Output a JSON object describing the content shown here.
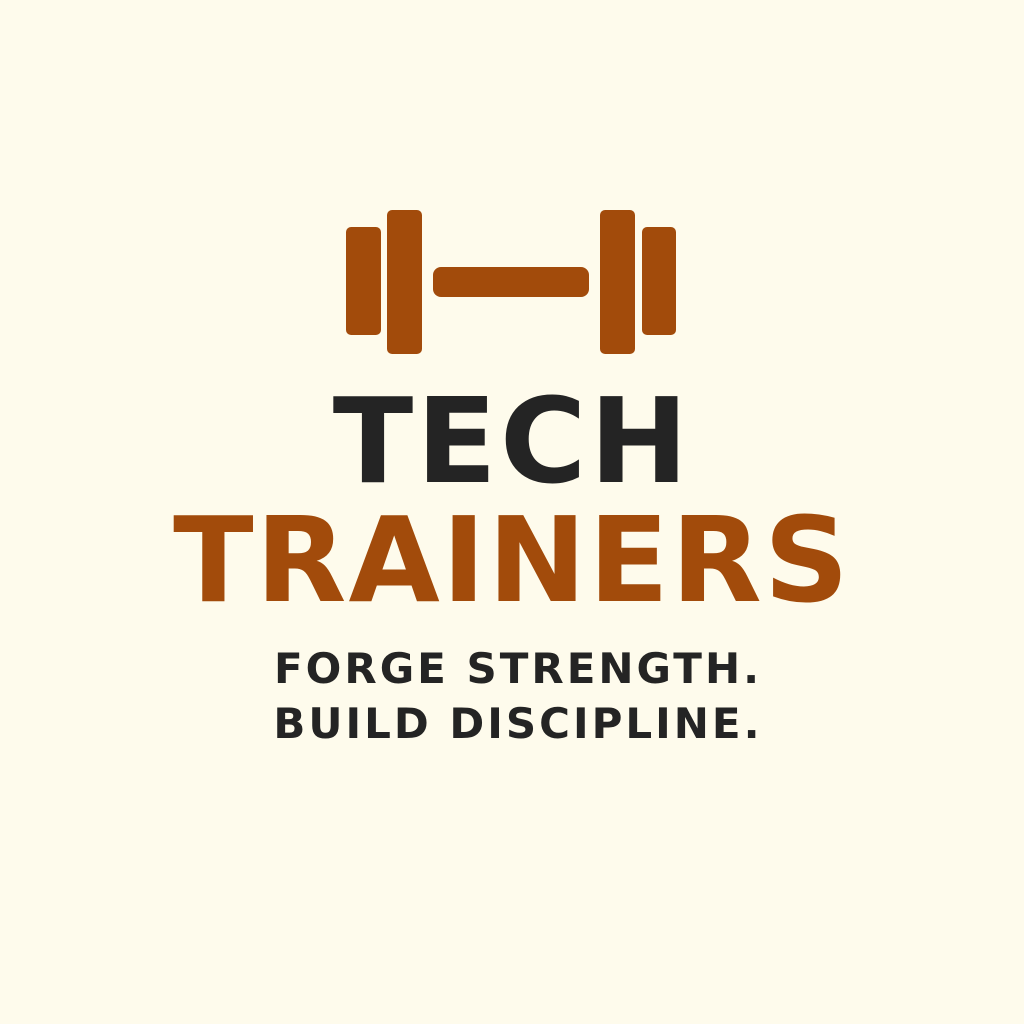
{
  "brand": {
    "title_line_1": "TECH",
    "title_line_2": "TRAINERS",
    "tagline_line_1": "FORGE STRENGTH.",
    "tagline_line_2": "BUILD DISCIPLINE."
  },
  "icon": {
    "name": "dumbbell-icon"
  },
  "colors": {
    "background": "#FEFBEC",
    "dark_text": "#242424",
    "accent": "#A24B0B"
  }
}
